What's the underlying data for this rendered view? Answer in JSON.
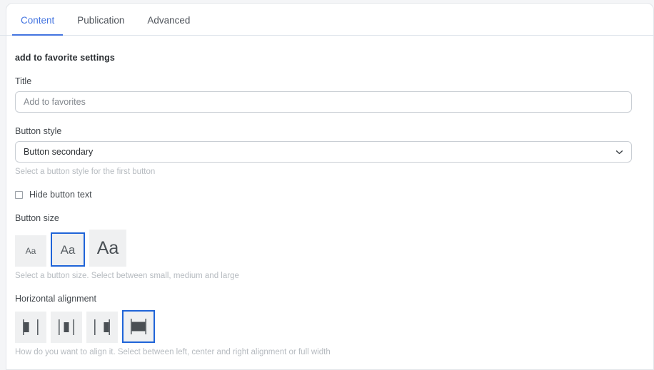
{
  "tabs": [
    {
      "label": "Content",
      "active": true
    },
    {
      "label": "Publication",
      "active": false
    },
    {
      "label": "Advanced",
      "active": false
    }
  ],
  "form": {
    "section_title": "add to favorite settings",
    "title_field": {
      "label": "Title",
      "value": "",
      "placeholder": "Add to favorites"
    },
    "button_style": {
      "label": "Button style",
      "selected": "Button secondary",
      "options": [
        "Button secondary"
      ],
      "help": "Select a button style for the first button",
      "chevron_icon": "chevron-down-icon"
    },
    "hide_button_text": {
      "label": "Hide button text",
      "checked": false
    },
    "button_size": {
      "label": "Button size",
      "help": "Select a button size. Select between small, medium and large",
      "options": [
        {
          "label": "Aa",
          "name": "small",
          "selected": false
        },
        {
          "label": "Aa",
          "name": "medium",
          "selected": true
        },
        {
          "label": "Aa",
          "name": "large",
          "selected": false
        }
      ]
    },
    "horizontal_alignment": {
      "label": "Horizontal alignment",
      "help": "How do you want to align it. Select between left, center and right alignment or full width",
      "options": [
        {
          "name": "left",
          "icon": "align-left-icon",
          "selected": false
        },
        {
          "name": "center",
          "icon": "align-center-icon",
          "selected": false
        },
        {
          "name": "right",
          "icon": "align-right-icon",
          "selected": false
        },
        {
          "name": "full-width",
          "icon": "align-full-width-icon",
          "selected": true
        }
      ]
    }
  },
  "colors": {
    "accent": "#4374e0",
    "selection_border": "#1f64d8",
    "option_bg": "#eff0f1",
    "icon_fill": "#4a4f54",
    "icon_line": "#5c6166",
    "help_text": "#b6bbc0"
  }
}
